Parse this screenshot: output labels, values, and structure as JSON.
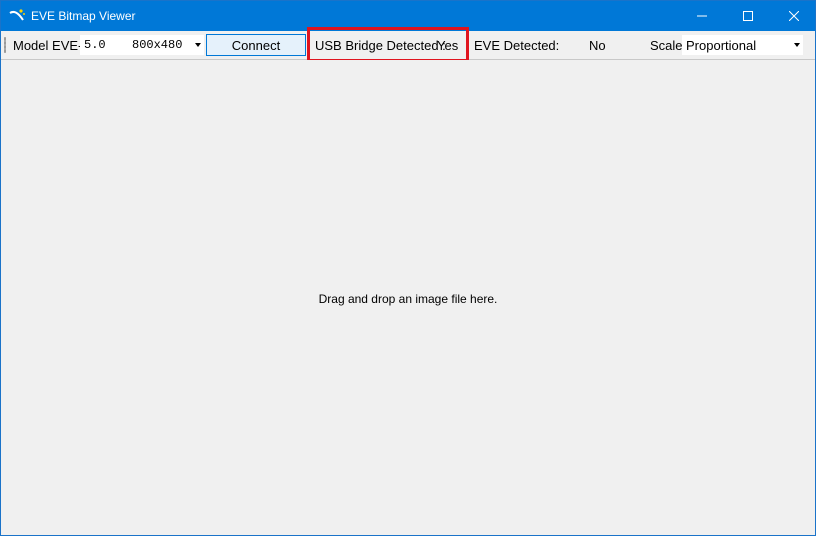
{
  "window": {
    "title": "EVE Bitmap Viewer",
    "icons": {
      "app": "app-logo-icon",
      "minimize": "minimize-icon",
      "maximize": "maximize-icon",
      "close": "close-icon"
    },
    "accent_color": "#0078d7"
  },
  "toolbar": {
    "model_label": "Model EVE-",
    "model_size": "5.0",
    "model_resolution": "800x480",
    "connect_label": "Connect",
    "usb_bridge_label": "USB Bridge Detected :",
    "usb_bridge_value": "Yes",
    "eve_detected_label": "EVE Detected:",
    "eve_detected_value": "No",
    "scale_label": "Scale",
    "scale_value": "Proportional",
    "highlight_color": "#e0141e"
  },
  "main": {
    "drop_hint": "Drag and drop an image file here."
  }
}
